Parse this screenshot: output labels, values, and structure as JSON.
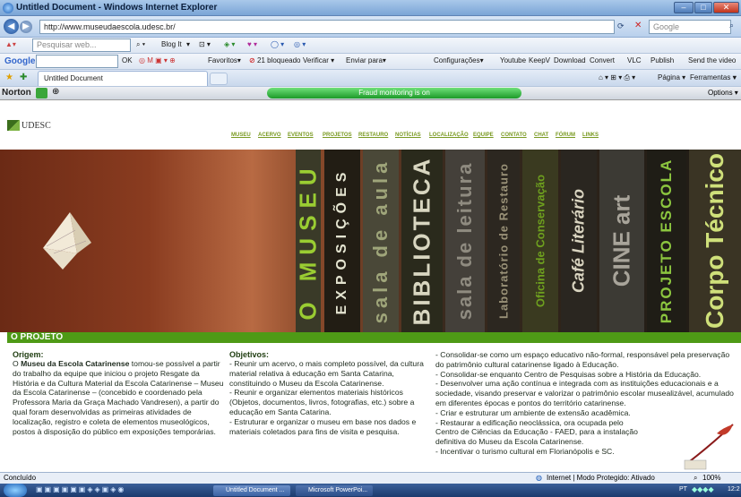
{
  "window": {
    "title": "Untitled Document - Windows Internet Explorer",
    "min": "–",
    "max": "□",
    "close": "✕"
  },
  "address_bar": {
    "url": "http://www.museudaescola.udesc.br/",
    "search_placeholder": "Google"
  },
  "toolbar1": {
    "search_placeholder": "Pesquisar web...",
    "blog": "Blog It",
    "items": [
      "▾",
      "⊡ ▾",
      "◈ ▾",
      "♥ ▾",
      "◯ ▾",
      "◎ ▾"
    ]
  },
  "toolbar2": {
    "google": "Google",
    "items": [
      "OK",
      "Favoritos▾",
      "21 bloqueado",
      "Verificar ▾",
      "Enviar para▾",
      "Configurações▾",
      "Youtube",
      "KeepV",
      "Download",
      "Convert",
      "VLC",
      "Publish",
      "Send the video"
    ]
  },
  "tabs": {
    "active": "Untitled Document",
    "right": [
      "Página ▾",
      "Ferramentas ▾",
      "▾"
    ]
  },
  "norton": {
    "label": "Norton",
    "fraud": "Fraud monitoring is on",
    "options": "Options ▾"
  },
  "site": {
    "logo": "UDESC",
    "nav": [
      "MUSEU",
      "ACERVO",
      "EVENTOS",
      "PROJETOS",
      "RESTAURO",
      "NOTÍCIAS",
      "LOCALIZAÇÃO",
      "EQUIPE",
      "CONTATO",
      "CHAT",
      "FÓRUM",
      "LINKS"
    ],
    "banner": [
      "O MUSEU",
      "EXPOSIÇÕES",
      "sala de aula",
      "BIBLIOTECA",
      "sala de leitura",
      "Laboratório de Restauro",
      "Oficina de Conservação",
      "Café Literário",
      "CINE art",
      "PROJETO ESCOLA",
      "Corpo Técnico"
    ],
    "section_title": "O PROJETO",
    "col1": {
      "heading": "Origem:",
      "prefix": "O ",
      "bold": "Museu da Escola Catarinense",
      "text": " tomou-se possível a partir do trabalho da equipe que iniciou o projeto Resgate da História e da Cultura Material da Escola Catarinense – Museu da Escola Catarinense – (concebido e coordenado pela Professora Maria da Graça Machado Vandresen), a partir do qual foram desenvolvidas as primeiras atividades de localização, registro e coleta de elementos museológicos, postos à disposição do público em exposições temporárias."
    },
    "col2": {
      "heading": "Objetivos:",
      "items": [
        "- Reunir um acervo, o mais completo possível, da cultura material relativa à educação em Santa Catarina, constituindo o Museu da Escola Catarinense.",
        " - Reunir e organizar elementos materiais históricos (Objetos, documentos, livros, fotografias, etc.) sobre a educação em Santa Catarina.",
        "- Estruturar e organizar o museu em base nos dados e materiais coletados para fins de visita e pesquisa."
      ]
    },
    "col3": {
      "items": [
        "- Consolidar-se como um espaço educativo não-formal, responsável pela preservação do patrimônio cultural catarinense ligado à Educação.",
        "- Consolidar-se enquanto Centro de Pesquisas sobre a História da Educação.",
        "- Desenvolver uma ação contínua e integrada com as instituições educacionais e a sociedade, visando preservar e valorizar o patrimônio escolar musealizável, acumulado em diferentes épocas e pontos do território catarinense.",
        "- Criar e estruturar um ambiente de extensão acadêmica.",
        "- Restaurar a edificação neoclássica, ora ocupada pelo",
        "Centro de Ciências da Educação - FAED, para a instalação",
        "definitiva do Museu da Escola Catarinense.",
        "- Incentivar o turismo cultural em Florianópolis e SC."
      ]
    }
  },
  "status": {
    "left": "Concluído",
    "zone": "Internet | Modo Protegido: Ativado",
    "zoom": "100%"
  },
  "taskbar": {
    "tasks": [
      "Untitled Document ...",
      "Microsoft PowerPoi..."
    ],
    "clock": "12:2",
    "lang": "PT"
  }
}
